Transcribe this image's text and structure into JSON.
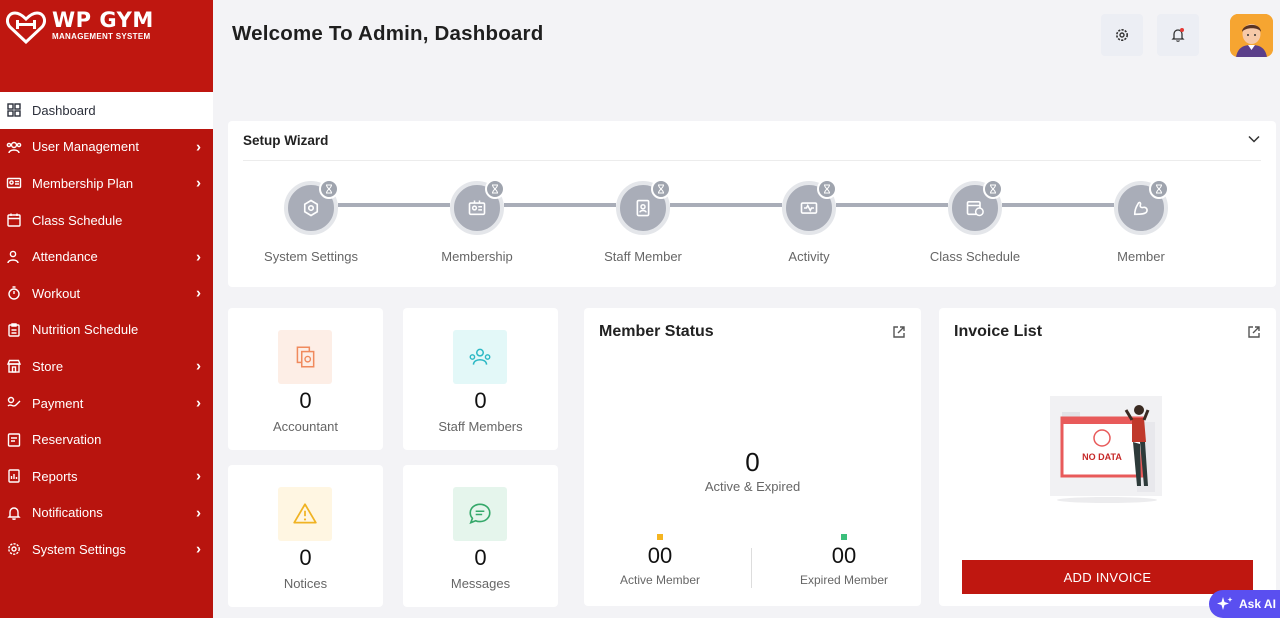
{
  "brand": {
    "title": "WP GYM",
    "subtitle": "MANAGEMENT SYSTEM",
    "color": "#b8140e"
  },
  "sidebar": {
    "items": [
      {
        "label": "Dashboard",
        "icon": "grid-icon",
        "active": true,
        "has_submenu": false
      },
      {
        "label": "User Management",
        "icon": "users-icon",
        "has_submenu": true
      },
      {
        "label": "Membership Plan",
        "icon": "id-card-icon",
        "has_submenu": true
      },
      {
        "label": "Class Schedule",
        "icon": "calendar-icon",
        "has_submenu": false
      },
      {
        "label": "Attendance",
        "icon": "user-check-icon",
        "has_submenu": true
      },
      {
        "label": "Workout",
        "icon": "stopwatch-icon",
        "has_submenu": true
      },
      {
        "label": "Nutrition Schedule",
        "icon": "clipboard-icon",
        "has_submenu": false
      },
      {
        "label": "Store",
        "icon": "store-icon",
        "has_submenu": true
      },
      {
        "label": "Payment",
        "icon": "payment-icon",
        "has_submenu": true
      },
      {
        "label": "Reservation",
        "icon": "reservation-icon",
        "has_submenu": false
      },
      {
        "label": "Reports",
        "icon": "report-icon",
        "has_submenu": true
      },
      {
        "label": "Notifications",
        "icon": "bell-icon",
        "has_submenu": true
      },
      {
        "label": "System Settings",
        "icon": "gear-icon",
        "has_submenu": true
      }
    ]
  },
  "header": {
    "title": "Welcome To Admin, Dashboard"
  },
  "wizard": {
    "title": "Setup Wizard",
    "steps": [
      {
        "label": "System Settings",
        "icon": "hexagon-settings-icon"
      },
      {
        "label": "Membership",
        "icon": "membership-card-icon"
      },
      {
        "label": "Staff Member",
        "icon": "staff-badge-icon"
      },
      {
        "label": "Activity",
        "icon": "activity-icon"
      },
      {
        "label": "Class Schedule",
        "icon": "schedule-icon"
      },
      {
        "label": "Member",
        "icon": "muscle-icon"
      }
    ]
  },
  "stats": [
    {
      "value": "0",
      "label": "Accountant",
      "icon": "accountant-icon",
      "bg": "#fdeee6",
      "color": "#f08a5d"
    },
    {
      "value": "0",
      "label": "Staff Members",
      "icon": "staff-icon",
      "bg": "#e3f8f8",
      "color": "#2bb8c4"
    },
    {
      "value": "0",
      "label": "Notices",
      "icon": "warning-icon",
      "bg": "#fff6e2",
      "color": "#f0b323"
    },
    {
      "value": "0",
      "label": "Messages",
      "icon": "chat-icon",
      "bg": "#e5f5ec",
      "color": "#35a86a"
    }
  ],
  "member_status": {
    "title": "Member Status",
    "total": "0",
    "total_label": "Active & Expired",
    "active_value": "00",
    "active_label": "Active Member",
    "active_color": "#f5b521",
    "expired_value": "00",
    "expired_label": "Expired Member",
    "expired_color": "#3bbf7b"
  },
  "invoice_list": {
    "title": "Invoice List",
    "empty_text": "NO DATA",
    "button": "ADD INVOICE"
  },
  "ask_ai": "Ask AI"
}
